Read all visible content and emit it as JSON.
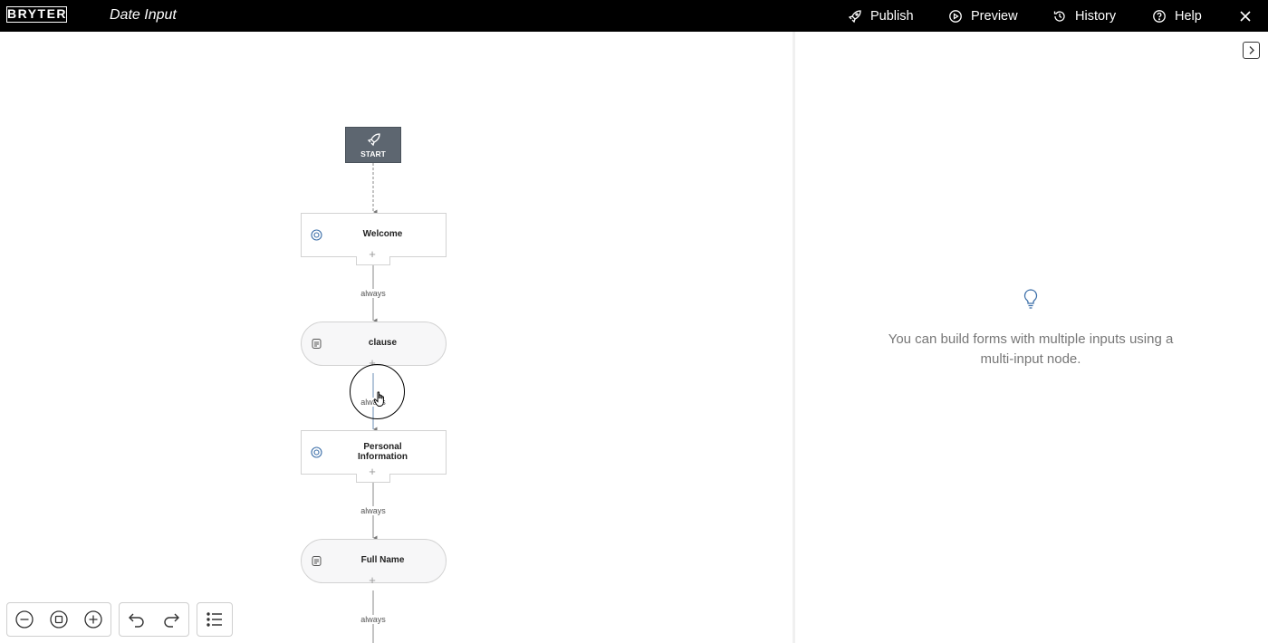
{
  "header": {
    "logo": "BRYTER",
    "title": "Date Input",
    "actions": [
      {
        "label": "Publish",
        "icon": "rocket-icon"
      },
      {
        "label": "Preview",
        "icon": "play-circle-icon"
      },
      {
        "label": "History",
        "icon": "history-icon"
      },
      {
        "label": "Help",
        "icon": "help-circle-icon"
      }
    ],
    "close_icon": "close-icon"
  },
  "flow": {
    "start_label": "START",
    "nodes": [
      {
        "label": "Welcome",
        "type": "input",
        "icon": "target-icon"
      },
      {
        "label": "clause",
        "type": "output",
        "icon": "document-icon"
      },
      {
        "label": "Personal Information",
        "type": "input",
        "icon": "target-icon"
      },
      {
        "label": "Full Name",
        "type": "output",
        "icon": "document-icon"
      }
    ],
    "edge_labels": [
      "always",
      "always",
      "always",
      "always"
    ],
    "add_symbol": "+"
  },
  "panel": {
    "tip_icon": "lightbulb-icon",
    "tip_text": "You can build forms with multiple inputs using a multi-input node."
  },
  "toolbar": {
    "zoom": [
      "zoom-out-icon",
      "fit-view-icon",
      "zoom-in-icon"
    ],
    "history": [
      "undo-icon",
      "redo-icon"
    ],
    "outline": "list-icon"
  },
  "colors": {
    "topbar": "#000000",
    "start_node": "#5d6670",
    "accent": "#3b6ea8",
    "edge": "#888888"
  }
}
